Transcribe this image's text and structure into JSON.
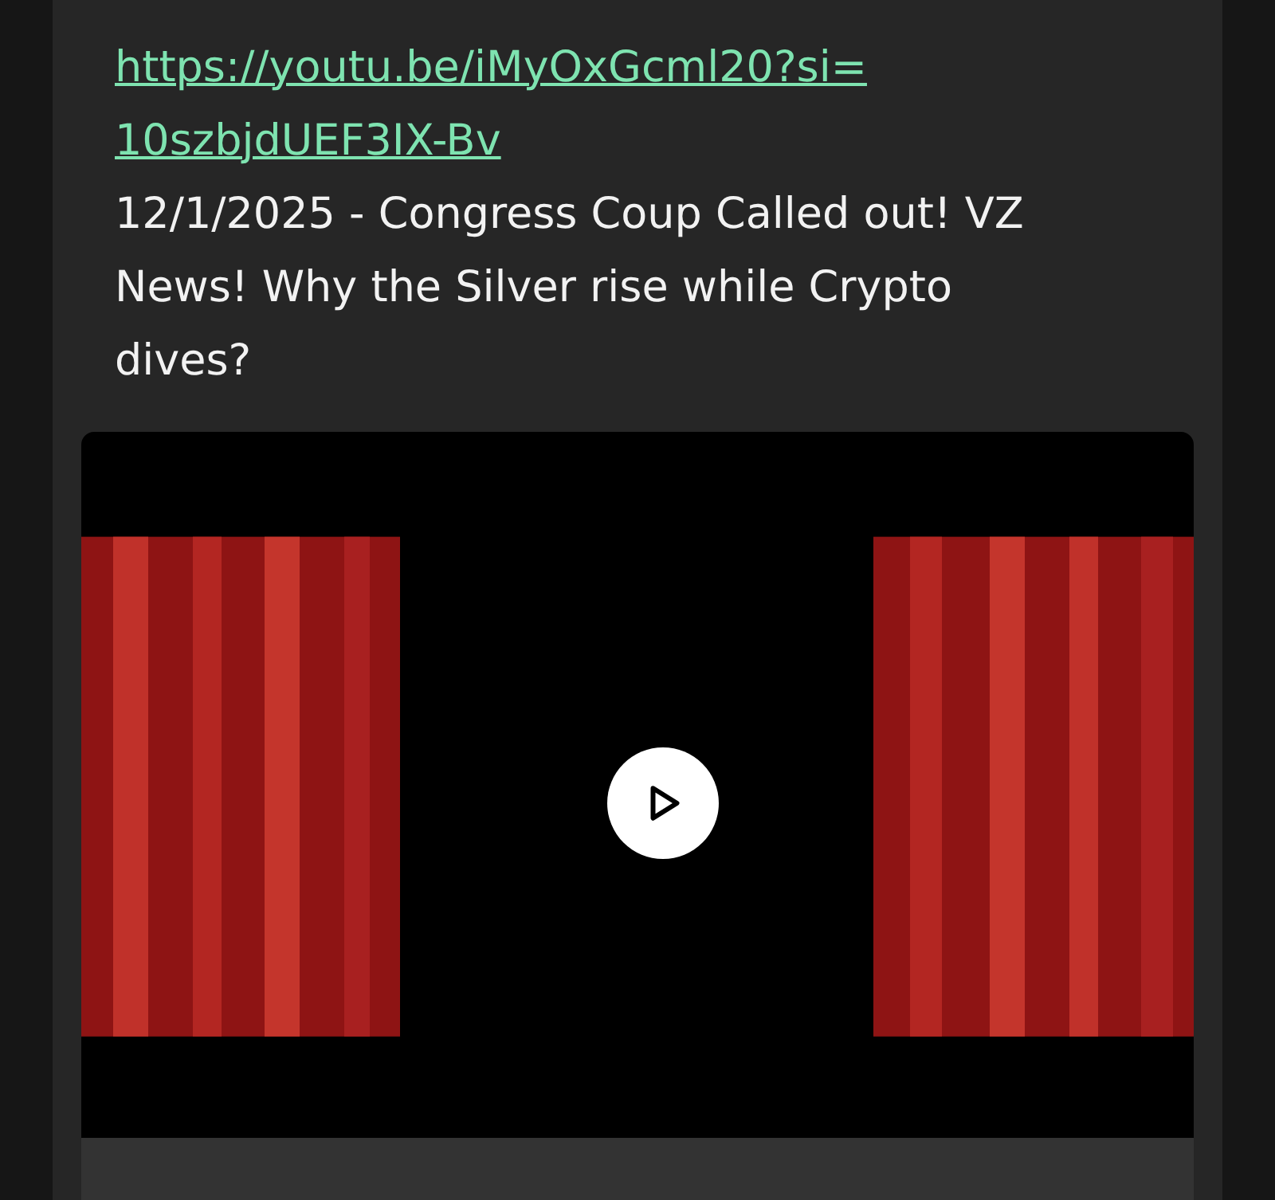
{
  "message": {
    "link": "https://youtu.be/iMyOxGcml20?si=10szbjdUEF3IX-Bv",
    "text": "12/1/2025 - Congress Coup Called out! VZ News! Why the Silver rise while Crypto dives?"
  }
}
